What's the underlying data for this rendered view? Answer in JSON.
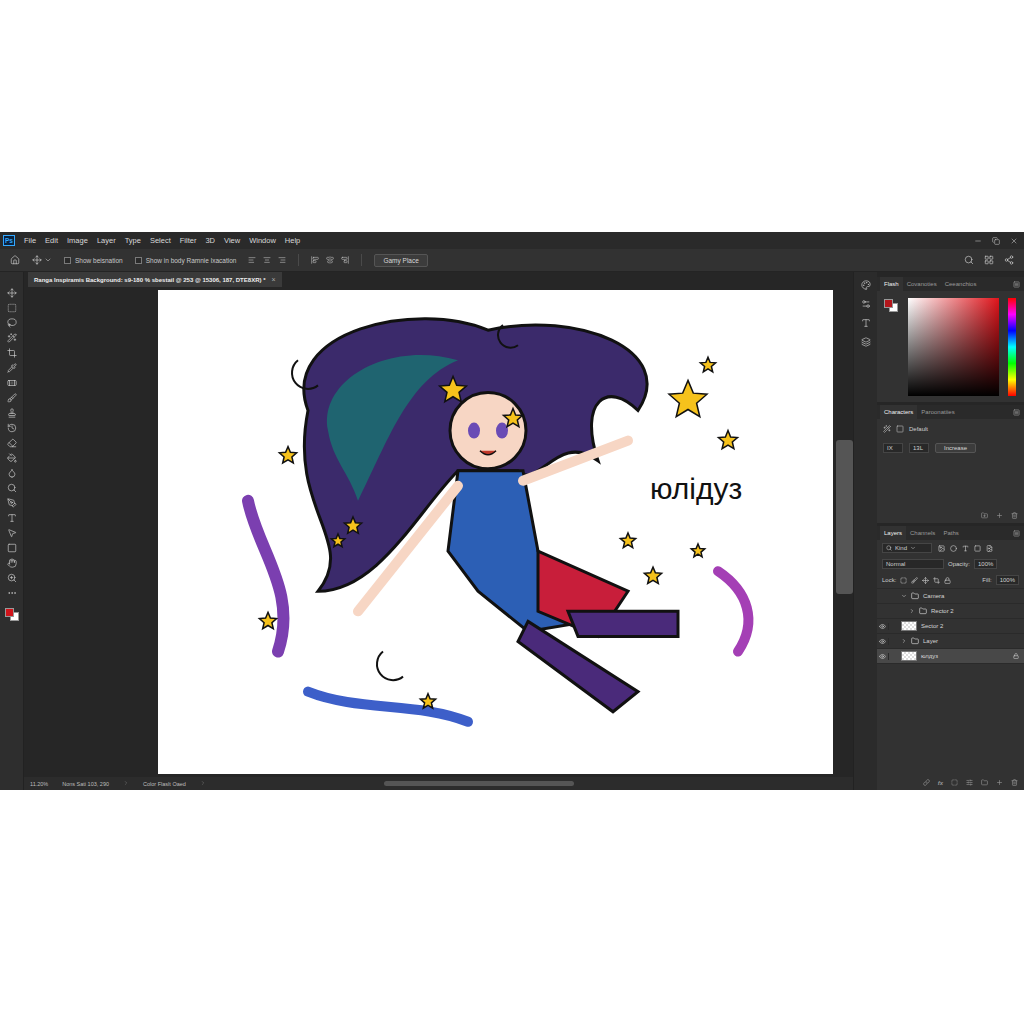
{
  "app": {
    "logo": "Ps"
  },
  "menu": [
    "File",
    "Edit",
    "Image",
    "Layer",
    "Type",
    "Select",
    "Filter",
    "3D",
    "View",
    "Window",
    "Help"
  ],
  "options_bar": {
    "checkboxes": [
      {
        "label": "Show beisnation",
        "checked": false
      },
      {
        "label": "Show in body Ramnie lxacation",
        "checked": false
      }
    ],
    "button": "Gamy Place"
  },
  "document_tab": {
    "title": "Ranga Inspiramis Background: s9-180 % sbestail @ 253 @ 15306, 187, DTE8XR) *",
    "close": "×"
  },
  "canvas": {
    "text": "юлідуз"
  },
  "color_panel": {
    "tabs": [
      {
        "label": "Flash",
        "selected": true
      },
      {
        "label": "Covanoties",
        "selected": false
      },
      {
        "label": "Ceeanchios",
        "selected": false
      }
    ]
  },
  "characters_panel": {
    "tabs": [
      {
        "label": "Characters",
        "selected": true
      },
      {
        "label": "Paroonatiies",
        "selected": false
      }
    ],
    "preset": "Default",
    "fields": [
      "IX",
      "13L"
    ],
    "button": "Increase"
  },
  "layers_panel": {
    "tabs": [
      {
        "label": "Layers",
        "selected": true
      },
      {
        "label": "Channels",
        "selected": false
      },
      {
        "label": "Paths",
        "selected": false
      }
    ],
    "filter": "Kind",
    "blend_mode": "Normal",
    "opacity_label": "Opacity:",
    "opacity": "100%",
    "lock_label": "Lock:",
    "fill_label": "Fill:",
    "fill": "100%",
    "layers": [
      {
        "name": "Camera",
        "kind": "group",
        "visible": false,
        "expanded": true,
        "nested": false,
        "selected": false,
        "locked": false
      },
      {
        "name": "Rector 2",
        "kind": "group",
        "visible": false,
        "expanded": false,
        "nested": true,
        "selected": false,
        "locked": false
      },
      {
        "name": "Sector 2",
        "kind": "layer",
        "visible": true,
        "expanded": false,
        "nested": false,
        "selected": false,
        "locked": false
      },
      {
        "name": "Layer",
        "kind": "group",
        "visible": true,
        "expanded": false,
        "nested": false,
        "selected": false,
        "locked": false
      },
      {
        "name": "юлдуз",
        "kind": "layer",
        "visible": true,
        "expanded": false,
        "nested": false,
        "selected": true,
        "locked": true
      }
    ],
    "footer_fx": "fx"
  },
  "status_bar": {
    "zoom": "11.20%",
    "document": "Nons Sati 103, 290",
    "info": "Color Flaslt Oaed"
  }
}
